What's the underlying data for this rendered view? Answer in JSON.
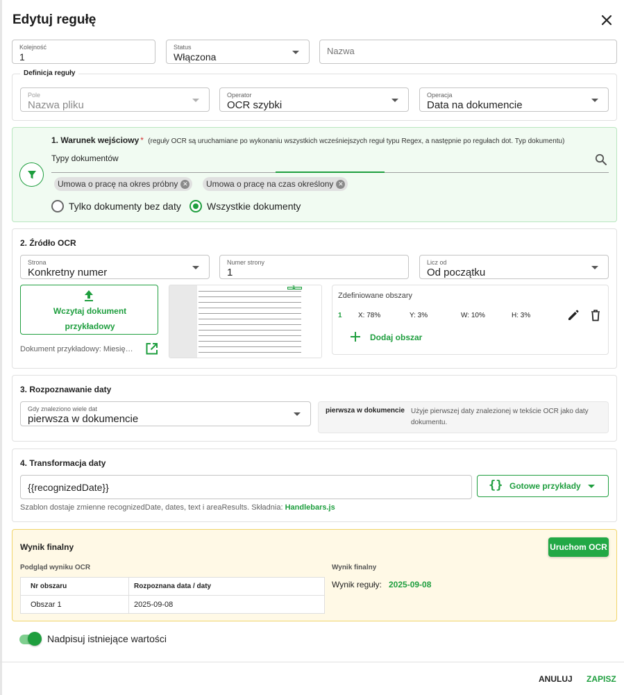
{
  "dialog": {
    "title": "Edytuj regułę",
    "close_icon": "close-icon"
  },
  "top_fields": {
    "order": {
      "label": "Kolejność",
      "value": "1"
    },
    "status": {
      "label": "Status",
      "value": "Włączona"
    },
    "name": {
      "placeholder": "Nazwa",
      "value": ""
    }
  },
  "definition": {
    "legend": "Definicja reguły",
    "field": {
      "label": "Pole",
      "value": "Nazwa pliku"
    },
    "operator": {
      "label": "Operator",
      "value": "OCR szybki"
    },
    "operation": {
      "label": "Operacja",
      "value": "Data na dokumencie"
    }
  },
  "entry_condition": {
    "title": "1. Warunek wejściowy",
    "required_mark": "*",
    "note": "(reguły OCR są uruchamiane po wykonaniu wszystkich wcześniejszych reguł typu Regex, a następnie po regułach dot. Typ dokumentu)",
    "filter_icon": "filter-icon",
    "search_label": "Typy dokumentów",
    "search_icon": "search-icon",
    "chips": [
      "Umowa o pracę na okres próbny",
      "Umowa o pracę na czas określony"
    ],
    "radio_options": [
      {
        "label": "Tylko dokumenty bez daty",
        "selected": false
      },
      {
        "label": "Wszystkie dokumenty",
        "selected": true
      }
    ]
  },
  "ocr_source": {
    "title": "2. Źródło OCR",
    "page": {
      "label": "Strona",
      "value": "Konkretny numer"
    },
    "page_number": {
      "label": "Numer strony",
      "value": "1"
    },
    "count_from": {
      "label": "Licz od",
      "value": "Od początku"
    },
    "upload_button": "Wczytaj dokument przykładowy",
    "upload_icon": "upload-icon",
    "sample_doc": "Dokument przykładowy: Miesię…",
    "open_icon": "open-in-new-icon",
    "areas_title": "Zdefiniowane obszary",
    "areas": [
      {
        "id": "1",
        "x": "X: 78%",
        "y": "Y: 3%",
        "w": "W: 10%",
        "h": "H: 3%"
      }
    ],
    "edit_icon": "pencil-icon",
    "delete_icon": "trash-icon",
    "add_area": "Dodaj obszar",
    "add_icon": "plus-icon",
    "preview_marker": "1"
  },
  "date_recognition": {
    "title": "3. Rozpoznawanie daty",
    "select": {
      "label": "Gdy znaleziono wiele dat",
      "value": "pierwsza w dokumencie"
    },
    "info_title": "pierwsza w dokumencie",
    "info_text": "Użyje pierwszej daty znalezionej w tekście OCR jako daty dokumentu."
  },
  "transformation": {
    "title": "4. Transformacja daty",
    "template_value": "{{recognizedDate}}",
    "examples_button": "Gotowe przykłady",
    "braces_icon": "code-braces-icon",
    "hint": "Szablon dostaje zmienne recognizedDate, dates, text i areaResults. Składnia:",
    "hint_link": "Handlebars.js"
  },
  "final_result": {
    "title": "Wynik finalny",
    "run_button": "Uruchom OCR",
    "preview_title": "Podgląd wyniku OCR",
    "table_headers": [
      "Nr obszaru",
      "Rozpoznana data / daty"
    ],
    "table_rows": [
      [
        "Obszar 1",
        "2025-09-08"
      ]
    ],
    "result_title": "Wynik finalny",
    "result_label": "Wynik reguły:",
    "result_value": "2025-09-08"
  },
  "overwrite": {
    "label": "Nadpisuj istniejące wartości",
    "on": true
  },
  "footer": {
    "cancel": "ANULUJ",
    "save": "ZAPISZ"
  },
  "colors": {
    "accent": "#1e9e3e",
    "green_panel": "#f1fbf2",
    "yellow_panel": "#fff9e6"
  }
}
